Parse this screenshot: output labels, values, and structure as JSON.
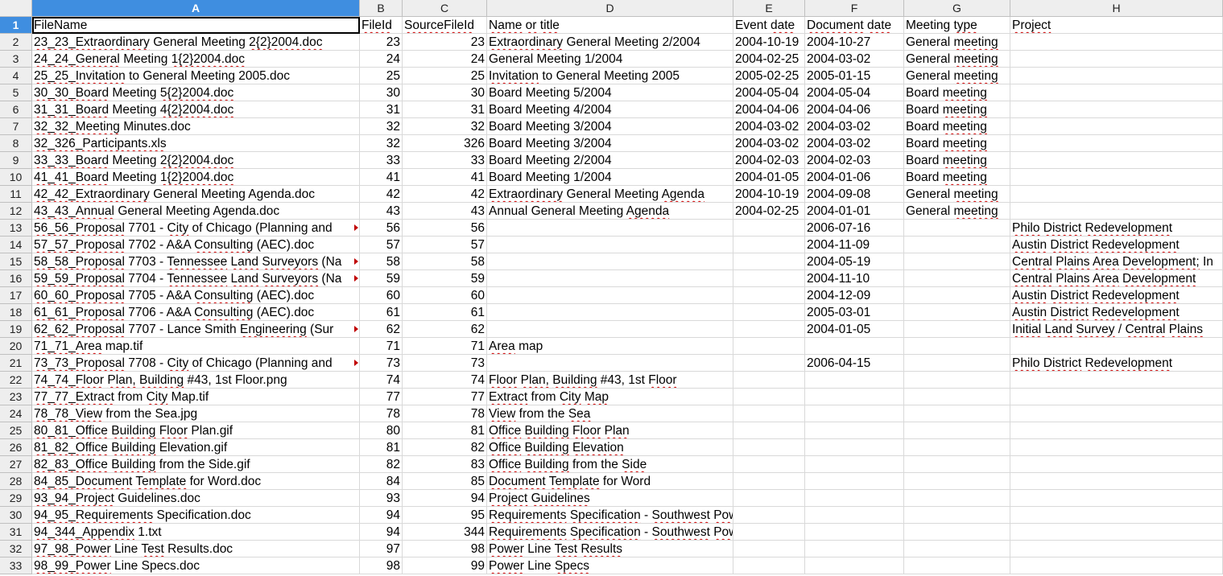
{
  "columns": [
    "A",
    "B",
    "C",
    "D",
    "E",
    "F",
    "G",
    "H"
  ],
  "selected_column": "A",
  "active_cell": "A1",
  "rows": [
    [
      "FileName",
      "FileId",
      "SourceFileId",
      "Name or title",
      "Event date",
      "Document date",
      "Meeting type",
      "Project"
    ],
    [
      "23_23_Extraordinary General Meeting 2{2}2004.doc",
      "23",
      "23",
      "Extraordinary General Meeting 2/2004",
      "2004-10-19",
      "2004-10-27",
      "General meeting",
      ""
    ],
    [
      "24_24_General Meeting 1{2}2004.doc",
      "24",
      "24",
      "General Meeting 1/2004",
      "2004-02-25",
      "2004-03-02",
      "General meeting",
      ""
    ],
    [
      "25_25_Invitation to General Meeting 2005.doc",
      "25",
      "25",
      "Invitation to General Meeting 2005",
      "2005-02-25",
      "2005-01-15",
      "General meeting",
      ""
    ],
    [
      "30_30_Board Meeting 5{2}2004.doc",
      "30",
      "30",
      "Board Meeting 5/2004",
      "2004-05-04",
      "2004-05-04",
      "Board meeting",
      ""
    ],
    [
      "31_31_Board Meeting 4{2}2004.doc",
      "31",
      "31",
      "Board Meeting 4/2004",
      "2004-04-06",
      "2004-04-06",
      "Board meeting",
      ""
    ],
    [
      "32_32_Meeting Minutes.doc",
      "32",
      "32",
      "Board Meeting 3/2004",
      "2004-03-02",
      "2004-03-02",
      "Board meeting",
      ""
    ],
    [
      "32_326_Participants.xls",
      "32",
      "326",
      "Board Meeting 3/2004",
      "2004-03-02",
      "2004-03-02",
      "Board meeting",
      ""
    ],
    [
      "33_33_Board Meeting 2{2}2004.doc",
      "33",
      "33",
      "Board Meeting 2/2004",
      "2004-02-03",
      "2004-02-03",
      "Board meeting",
      ""
    ],
    [
      "41_41_Board Meeting 1{2}2004.doc",
      "41",
      "41",
      "Board Meeting 1/2004",
      "2004-01-05",
      "2004-01-06",
      "Board meeting",
      ""
    ],
    [
      "42_42_Extraordinary General Meeting Agenda.doc",
      "42",
      "42",
      "Extraordinary General Meeting Agenda",
      "2004-10-19",
      "2004-09-08",
      "General meeting",
      ""
    ],
    [
      "43_43_Annual General Meeting Agenda.doc",
      "43",
      "43",
      "Annual General Meeting Agenda",
      "2004-02-25",
      "2004-01-01",
      "General meeting",
      ""
    ],
    [
      "56_56_Proposal 7701 - City of Chicago (Planning and",
      "56",
      "56",
      "",
      "",
      "2006-07-16",
      "",
      "Philo District Redevelopment"
    ],
    [
      "57_57_Proposal 7702 - A&A Consulting (AEC).doc",
      "57",
      "57",
      "",
      "",
      "2004-11-09",
      "",
      "Austin District Redevelopment"
    ],
    [
      "58_58_Proposal 7703 - Tennessee Land Surveyors (Na",
      "58",
      "58",
      "",
      "",
      "2004-05-19",
      "",
      "Central Plains Area Development; In"
    ],
    [
      "59_59_Proposal 7704 - Tennessee Land Surveyors (Na",
      "59",
      "59",
      "",
      "",
      "2004-11-10",
      "",
      "Central Plains Area Development"
    ],
    [
      "60_60_Proposal 7705 - A&A Consulting (AEC).doc",
      "60",
      "60",
      "",
      "",
      "2004-12-09",
      "",
      "Austin District Redevelopment"
    ],
    [
      "61_61_Proposal 7706 - A&A Consulting (AEC).doc",
      "61",
      "61",
      "",
      "",
      "2005-03-01",
      "",
      "Austin District Redevelopment"
    ],
    [
      "62_62_Proposal 7707 - Lance Smith Engineering (Sur",
      "62",
      "62",
      "",
      "",
      "2004-01-05",
      "",
      "Initial Land Survey / Central Plains"
    ],
    [
      "71_71_Area map.tif",
      "71",
      "71",
      "Area map",
      "",
      "",
      "",
      ""
    ],
    [
      "73_73_Proposal 7708 - City of Chicago (Planning and",
      "73",
      "73",
      "",
      "",
      "2006-04-15",
      "",
      "Philo District Redevelopment"
    ],
    [
      "74_74_Floor Plan, Building #43, 1st Floor.png",
      "74",
      "74",
      "Floor Plan, Building #43, 1st Floor",
      "",
      "",
      "",
      ""
    ],
    [
      "77_77_Extract from City Map.tif",
      "77",
      "77",
      "Extract from City Map",
      "",
      "",
      "",
      ""
    ],
    [
      "78_78_View from the Sea.jpg",
      "78",
      "78",
      "View from the Sea",
      "",
      "",
      "",
      ""
    ],
    [
      "80_81_Office Building Floor Plan.gif",
      "80",
      "81",
      "Office Building Floor Plan",
      "",
      "",
      "",
      ""
    ],
    [
      "81_82_Office Building Elevation.gif",
      "81",
      "82",
      "Office Building Elevation",
      "",
      "",
      "",
      ""
    ],
    [
      "82_83_Office Building from the Side.gif",
      "82",
      "83",
      "Office Building from the Side",
      "",
      "",
      "",
      ""
    ],
    [
      "84_85_Document Template for Word.doc",
      "84",
      "85",
      "Document Template for Word",
      "",
      "",
      "",
      ""
    ],
    [
      "93_94_Project Guidelines.doc",
      "93",
      "94",
      "Project Guidelines",
      "",
      "",
      "",
      ""
    ],
    [
      "94_95_Requirements Specification.doc",
      "94",
      "95",
      "Requirements Specification - Southwest Power",
      "",
      "",
      "",
      ""
    ],
    [
      "94_344_Appendix 1.txt",
      "94",
      "344",
      "Requirements Specification - Southwest Power",
      "",
      "",
      "",
      ""
    ],
    [
      "97_98_Power Line Test Results.doc",
      "97",
      "98",
      "Power Line Test Results",
      "",
      "",
      "",
      ""
    ],
    [
      "98_99_Power Line Specs.doc",
      "98",
      "99",
      "Power Line Specs",
      "",
      "",
      "",
      ""
    ]
  ],
  "overflow_rows": [
    13,
    15,
    16,
    19,
    21
  ],
  "spellcheck_words": [
    "FileName",
    "FileId",
    "SourceFileId",
    "Extraordinary",
    "Invitation",
    "Minutes",
    "Participants",
    "Agenda",
    "Proposal",
    "Consulting",
    "AEC",
    "Tennessee",
    "Surveyors",
    "Engineering",
    "Floor",
    "Building",
    "Extract",
    "City",
    "View",
    "Sea",
    "Office",
    "Plan",
    "Elevation",
    "Side",
    "Document",
    "Template",
    "Project",
    "Guidelines",
    "Requirements",
    "Specification",
    "Southwest",
    "Appendix",
    "Power",
    "Specs",
    "Test",
    "Results",
    "Redevelopment",
    "Development",
    "Survey",
    "Philo",
    "District",
    "Austin",
    "Central",
    "Plains",
    "Area",
    "Initial",
    "Land",
    "meeting",
    "title",
    "date",
    "type",
    "Name",
    "or",
    "Map"
  ]
}
